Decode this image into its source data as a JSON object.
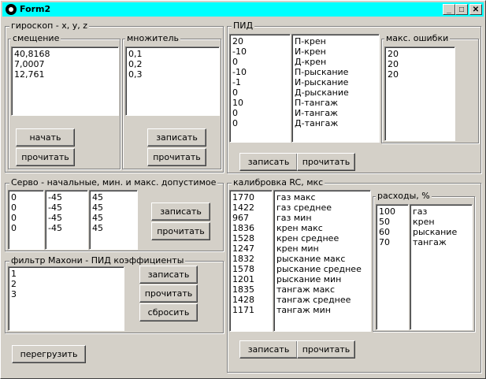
{
  "window": {
    "title": "Form2",
    "min_glyph": "_",
    "max_glyph": "□",
    "close_glyph": "✕"
  },
  "gyro": {
    "label": "гироскоп - x, y, z",
    "offset": {
      "label": "смещение",
      "values": [
        "40,8168",
        "7,0007",
        "12,761"
      ]
    },
    "multiplier": {
      "label": "множитель",
      "values": [
        "0,1",
        "0,2",
        "0,3"
      ]
    },
    "start_label": "начать",
    "read_label": "прочитать",
    "write_label": "записать",
    "read2_label": "прочитать"
  },
  "servo": {
    "label": "Серво - начальные, мин. и макс. допустимое",
    "col1": [
      "0",
      "0",
      "0",
      "0"
    ],
    "col2": [
      "-45",
      "-45",
      "-45",
      "-45"
    ],
    "col3": [
      "45",
      "45",
      "45",
      "45"
    ],
    "write_label": "записать",
    "read_label": "прочитать"
  },
  "mahony": {
    "label": "фильтр Махони - ПИД коэффициенты",
    "values": [
      "1",
      "2",
      "3"
    ],
    "write_label": "записать",
    "read_label": "прочитать",
    "reset_label": "сбросить"
  },
  "reboot_label": "перегрузить",
  "pid": {
    "label": "ПИД",
    "values": [
      "20",
      "-10",
      "0",
      "-10",
      "-1",
      "0",
      "10",
      "0",
      "0"
    ],
    "names": [
      "П-крен",
      "И-крен",
      "Д-крен",
      "П-рыскание",
      "И-рыскание",
      "Д-рыскание",
      "П-тангаж",
      "И-тангаж",
      "Д-тангаж"
    ],
    "max_errors": {
      "label": "макс. ошибки",
      "values": [
        "20",
        "20",
        "20"
      ]
    },
    "write_label": "записать",
    "read_label": "прочитать"
  },
  "rc": {
    "label": "калибровка RC, мкс",
    "values": [
      "1770",
      "1422",
      "967",
      "1836",
      "1528",
      "1247",
      "1832",
      "1578",
      "1201",
      "1835",
      "1428",
      "1171"
    ],
    "names": [
      "газ макс",
      "газ среднее",
      "газ мин",
      "крен макс",
      "крен среднее",
      "крен мин",
      "рыскание макс",
      "рыскание среднее",
      "рыскание мин",
      "тангаж макс",
      "тангаж среднее",
      "тангаж мин"
    ],
    "rates": {
      "label": "расходы, %",
      "values": [
        "100",
        "50",
        "60",
        "70"
      ],
      "names": [
        "газ",
        "крен",
        "рыскание",
        "тангаж"
      ]
    },
    "write_label": "записать",
    "read_label": "прочитать"
  }
}
